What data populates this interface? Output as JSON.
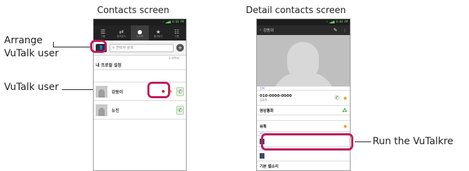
{
  "captions": {
    "contacts_screen": "Contacts screen",
    "detail_screen": "Detail contacts screen"
  },
  "callouts": {
    "arrange_line1": "Arrange",
    "arrange_line2": "VuTalk user",
    "vutalk_user": "VuTalk user",
    "run_vutalk": "Run the VuTalkre"
  },
  "phone1": {
    "status": "⚡ ▂▄▆ 0:00 PM",
    "tabs": [
      {
        "icon": "☰",
        "label": "그룹"
      },
      {
        "icon": "⇄",
        "label": "즐겨찾기"
      },
      {
        "icon": "●",
        "label": "주소록"
      },
      {
        "icon": "★",
        "label": "즐겨찾기"
      },
      {
        "icon": "☷",
        "label": "그룹"
      }
    ],
    "search_placeholder": "연락처 검색",
    "section_right": "3 연락처",
    "my_profile": "내 프로필 설정",
    "contacts": [
      {
        "name": "강동이"
      },
      {
        "name": "뉴진"
      }
    ]
  },
  "phone2": {
    "status": "⚡ ▂▄▆ 0:00 PM",
    "title": "강동이",
    "phone_section": "전화",
    "phone_number": "010-0000-0000",
    "phone_type": "휴대폰",
    "video_call": "영상통화",
    "vutalk_label": "뷰톡",
    "sec3": "메모",
    "sec4": "그룹",
    "ringtone": "기본 벨소리"
  },
  "colors": {
    "highlight": "#c2195e",
    "call_green": "#3a9a3a",
    "vutalk_orange": "#f0a020"
  }
}
